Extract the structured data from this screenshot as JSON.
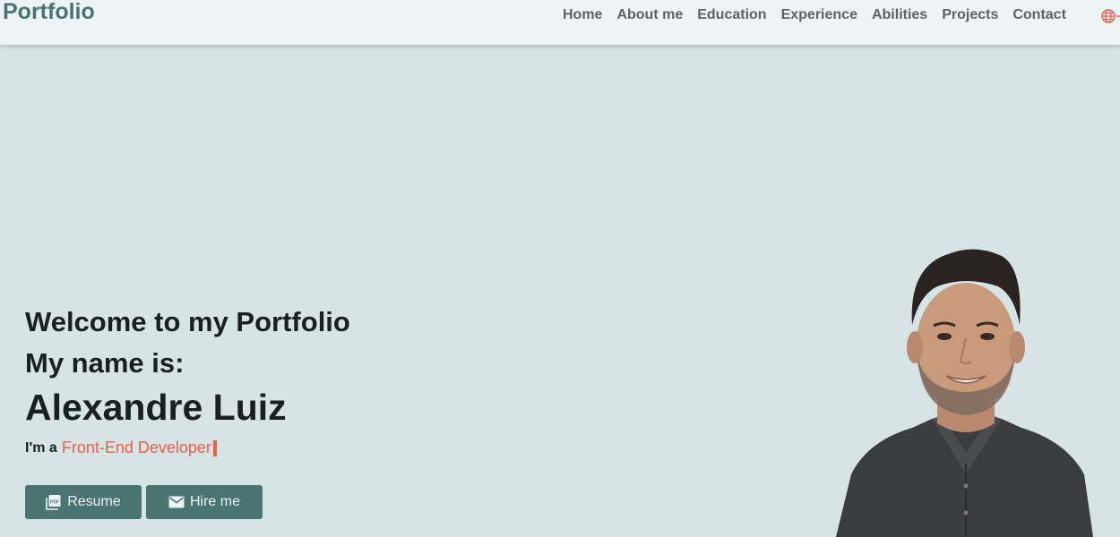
{
  "header": {
    "brand": "Portfolio",
    "nav": [
      {
        "label": "Home"
      },
      {
        "label": "About me"
      },
      {
        "label": "Education"
      },
      {
        "label": "Experience"
      },
      {
        "label": "Abilities"
      },
      {
        "label": "Projects"
      },
      {
        "label": "Contact"
      }
    ],
    "language_icon": "globe-icon"
  },
  "hero": {
    "welcome": "Welcome to my Portfolio",
    "name_label": "My name is:",
    "name": "Alexandre Luiz",
    "tagline_prefix": "I'm a",
    "role": "Front-End Developer",
    "role_color": "#e8604c"
  },
  "buttons": {
    "resume_label": "Resume",
    "resume_icon": "pdf-icon",
    "hire_label": "Hire me",
    "hire_icon": "mail-icon"
  },
  "colors": {
    "background": "#d6e4e5",
    "navbar": "#eef4f4",
    "accent": "#4a7472",
    "highlight": "#e8604c"
  }
}
